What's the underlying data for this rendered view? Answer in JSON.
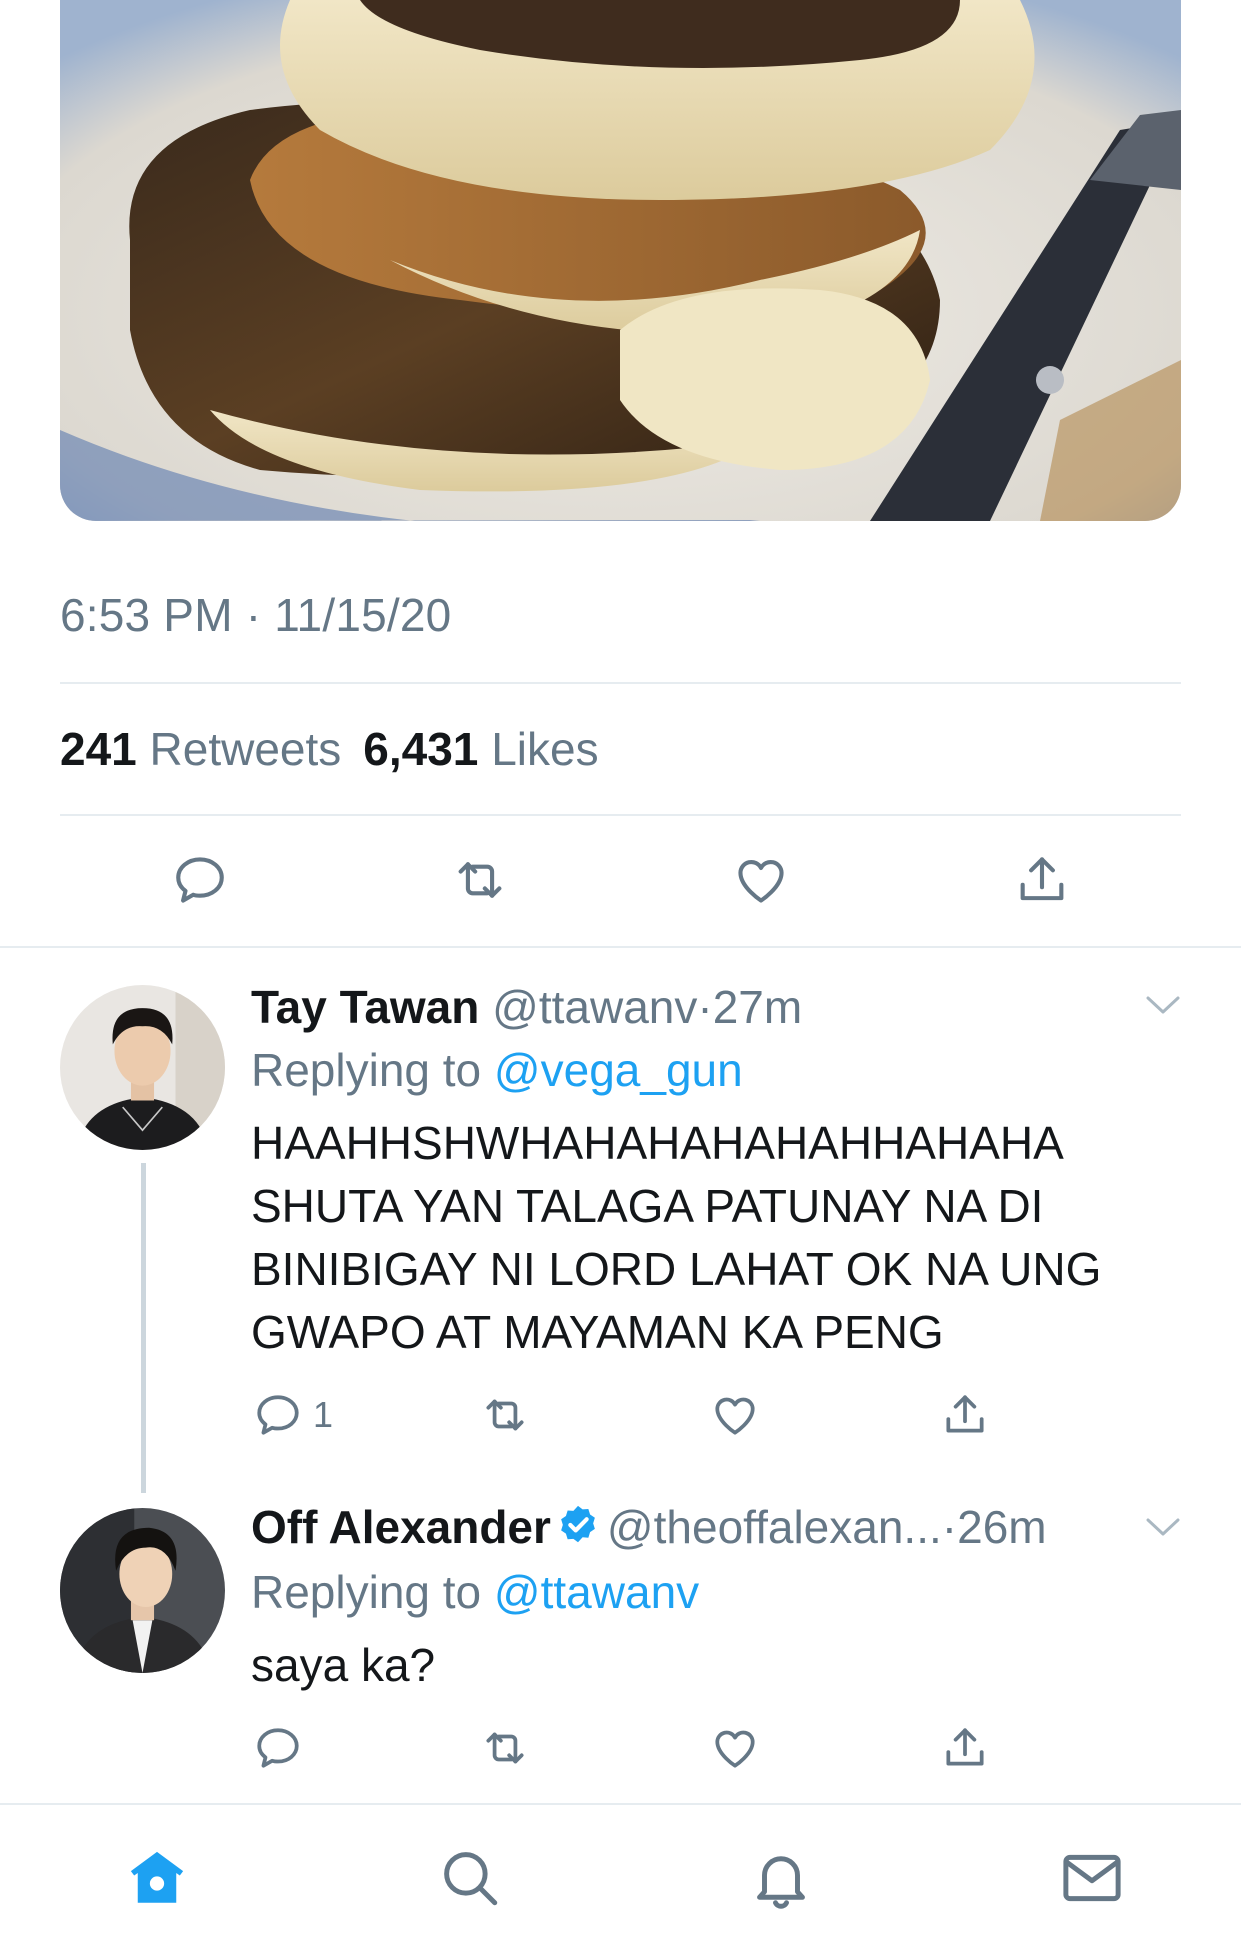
{
  "tweet": {
    "timestamp": "6:53 PM · 11/15/20",
    "stats": {
      "retweets_count": "241",
      "retweets_label": "Retweets",
      "likes_count": "6,431",
      "likes_label": "Likes"
    },
    "actions": [
      "reply-icon",
      "retweet-icon",
      "like-icon",
      "share-icon"
    ]
  },
  "replies": [
    {
      "name": "Tay Tawan",
      "handle": "@ttawanv",
      "separator": "·",
      "time": "27m",
      "replying_prefix": "Replying to",
      "replying_to": "@vega_gun",
      "lines": [
        "HAAHHSHWHAHAHAHAHAHHAHAHA",
        "SHUTA YAN TALAGA PATUNAY NA DI",
        "BINIBIGAY NI LORD LAHAT OK NA UNG",
        "GWAPO AT MAYAMAN KA PENG"
      ],
      "reply_count": "1",
      "verified": false
    },
    {
      "name": "Off Alexander",
      "handle": "@theoffalexan...",
      "separator": "·",
      "time": "26m",
      "replying_prefix": "Replying to",
      "replying_to": "@ttawanv",
      "lines": [
        "saya ka?"
      ],
      "reply_count": "",
      "verified": true
    }
  ],
  "colors": {
    "accent": "#1da1f2",
    "muted": "#657786",
    "text": "#14171a",
    "divider": "#e6ecf0"
  },
  "tabbar": {
    "tabs": [
      "home-icon",
      "search-icon",
      "notifications-icon",
      "messages-icon"
    ],
    "active": "home-icon"
  }
}
